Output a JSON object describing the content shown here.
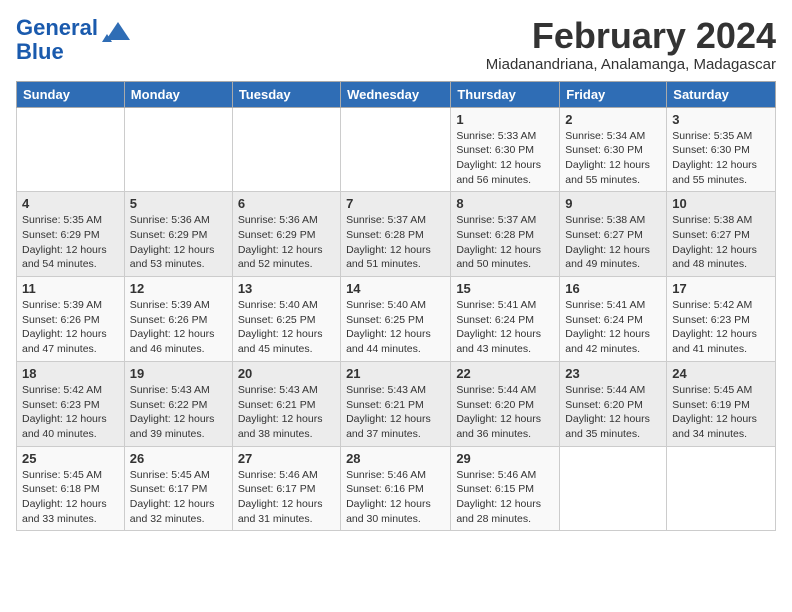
{
  "header": {
    "logo_line1": "General",
    "logo_line2": "Blue",
    "title": "February 2024",
    "subtitle": "Miadanandriana, Analamanga, Madagascar"
  },
  "weekdays": [
    "Sunday",
    "Monday",
    "Tuesday",
    "Wednesday",
    "Thursday",
    "Friday",
    "Saturday"
  ],
  "weeks": [
    [
      {
        "day": "",
        "info": ""
      },
      {
        "day": "",
        "info": ""
      },
      {
        "day": "",
        "info": ""
      },
      {
        "day": "",
        "info": ""
      },
      {
        "day": "1",
        "info": "Sunrise: 5:33 AM\nSunset: 6:30 PM\nDaylight: 12 hours\nand 56 minutes."
      },
      {
        "day": "2",
        "info": "Sunrise: 5:34 AM\nSunset: 6:30 PM\nDaylight: 12 hours\nand 55 minutes."
      },
      {
        "day": "3",
        "info": "Sunrise: 5:35 AM\nSunset: 6:30 PM\nDaylight: 12 hours\nand 55 minutes."
      }
    ],
    [
      {
        "day": "4",
        "info": "Sunrise: 5:35 AM\nSunset: 6:29 PM\nDaylight: 12 hours\nand 54 minutes."
      },
      {
        "day": "5",
        "info": "Sunrise: 5:36 AM\nSunset: 6:29 PM\nDaylight: 12 hours\nand 53 minutes."
      },
      {
        "day": "6",
        "info": "Sunrise: 5:36 AM\nSunset: 6:29 PM\nDaylight: 12 hours\nand 52 minutes."
      },
      {
        "day": "7",
        "info": "Sunrise: 5:37 AM\nSunset: 6:28 PM\nDaylight: 12 hours\nand 51 minutes."
      },
      {
        "day": "8",
        "info": "Sunrise: 5:37 AM\nSunset: 6:28 PM\nDaylight: 12 hours\nand 50 minutes."
      },
      {
        "day": "9",
        "info": "Sunrise: 5:38 AM\nSunset: 6:27 PM\nDaylight: 12 hours\nand 49 minutes."
      },
      {
        "day": "10",
        "info": "Sunrise: 5:38 AM\nSunset: 6:27 PM\nDaylight: 12 hours\nand 48 minutes."
      }
    ],
    [
      {
        "day": "11",
        "info": "Sunrise: 5:39 AM\nSunset: 6:26 PM\nDaylight: 12 hours\nand 47 minutes."
      },
      {
        "day": "12",
        "info": "Sunrise: 5:39 AM\nSunset: 6:26 PM\nDaylight: 12 hours\nand 46 minutes."
      },
      {
        "day": "13",
        "info": "Sunrise: 5:40 AM\nSunset: 6:25 PM\nDaylight: 12 hours\nand 45 minutes."
      },
      {
        "day": "14",
        "info": "Sunrise: 5:40 AM\nSunset: 6:25 PM\nDaylight: 12 hours\nand 44 minutes."
      },
      {
        "day": "15",
        "info": "Sunrise: 5:41 AM\nSunset: 6:24 PM\nDaylight: 12 hours\nand 43 minutes."
      },
      {
        "day": "16",
        "info": "Sunrise: 5:41 AM\nSunset: 6:24 PM\nDaylight: 12 hours\nand 42 minutes."
      },
      {
        "day": "17",
        "info": "Sunrise: 5:42 AM\nSunset: 6:23 PM\nDaylight: 12 hours\nand 41 minutes."
      }
    ],
    [
      {
        "day": "18",
        "info": "Sunrise: 5:42 AM\nSunset: 6:23 PM\nDaylight: 12 hours\nand 40 minutes."
      },
      {
        "day": "19",
        "info": "Sunrise: 5:43 AM\nSunset: 6:22 PM\nDaylight: 12 hours\nand 39 minutes."
      },
      {
        "day": "20",
        "info": "Sunrise: 5:43 AM\nSunset: 6:21 PM\nDaylight: 12 hours\nand 38 minutes."
      },
      {
        "day": "21",
        "info": "Sunrise: 5:43 AM\nSunset: 6:21 PM\nDaylight: 12 hours\nand 37 minutes."
      },
      {
        "day": "22",
        "info": "Sunrise: 5:44 AM\nSunset: 6:20 PM\nDaylight: 12 hours\nand 36 minutes."
      },
      {
        "day": "23",
        "info": "Sunrise: 5:44 AM\nSunset: 6:20 PM\nDaylight: 12 hours\nand 35 minutes."
      },
      {
        "day": "24",
        "info": "Sunrise: 5:45 AM\nSunset: 6:19 PM\nDaylight: 12 hours\nand 34 minutes."
      }
    ],
    [
      {
        "day": "25",
        "info": "Sunrise: 5:45 AM\nSunset: 6:18 PM\nDaylight: 12 hours\nand 33 minutes."
      },
      {
        "day": "26",
        "info": "Sunrise: 5:45 AM\nSunset: 6:17 PM\nDaylight: 12 hours\nand 32 minutes."
      },
      {
        "day": "27",
        "info": "Sunrise: 5:46 AM\nSunset: 6:17 PM\nDaylight: 12 hours\nand 31 minutes."
      },
      {
        "day": "28",
        "info": "Sunrise: 5:46 AM\nSunset: 6:16 PM\nDaylight: 12 hours\nand 30 minutes."
      },
      {
        "day": "29",
        "info": "Sunrise: 5:46 AM\nSunset: 6:15 PM\nDaylight: 12 hours\nand 28 minutes."
      },
      {
        "day": "",
        "info": ""
      },
      {
        "day": "",
        "info": ""
      }
    ]
  ]
}
